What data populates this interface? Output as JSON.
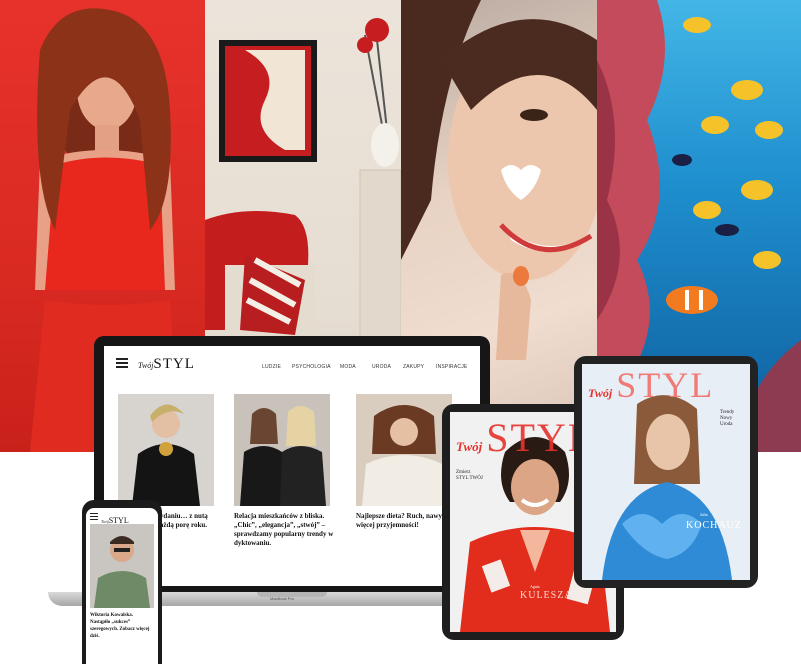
{
  "brand": {
    "logo_prefix": "Twój",
    "logo_main": "STYL",
    "accent": "#e8322b"
  },
  "laptop": {
    "nav": [
      "LUDZIE",
      "PSYCHOLOGIA",
      "MODA",
      "URODA",
      "ZAKUPY",
      "INSPIRACJE"
    ],
    "articles": [
      {
        "text": "Styl retro w wydaniu… z nutą rewelacji na każdą porę roku."
      },
      {
        "text": "Relacja mieszkańców z bliska. „Chic”, „elegancja”, „stwój” – sprawdzamy popularny trendy w dyktowaniu."
      },
      {
        "text": "Najlepsze dieta? Ruch, nawyki i więcej przyjemności!"
      }
    ],
    "base_label": "MacBook Pro"
  },
  "phone": {
    "article_text": "Wiktoria Kowalska. Nastąpiło „sukces” szeregowych. Zobacz więcej dziś."
  },
  "tabletA": {
    "cover_name_first": "Agata",
    "cover_name_last": "KULESZA",
    "side_lines": [
      "Zmierz",
      "STYL TWÓJ",
      "Trendy",
      "Moda"
    ]
  },
  "tabletB": {
    "cover_name_first": "Julia",
    "cover_name_last": "KOCHAUZ",
    "side_lines": [
      "Trendy",
      "Nowy",
      "Uroda"
    ]
  }
}
